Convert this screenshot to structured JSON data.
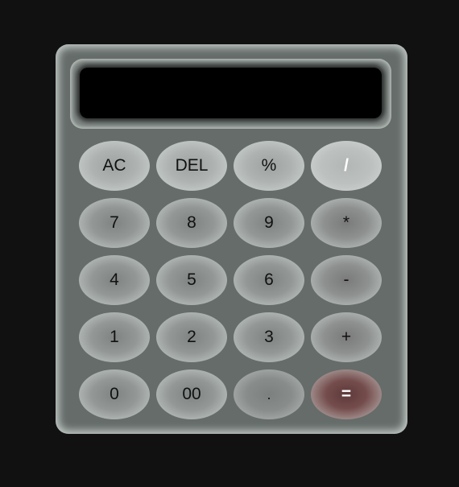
{
  "display": {
    "value": ""
  },
  "keys": [
    {
      "label": "AC",
      "name": "all-clear-button"
    },
    {
      "label": "DEL",
      "name": "delete-button"
    },
    {
      "label": "%",
      "name": "percent-button"
    },
    {
      "label": "/",
      "name": "divide-button"
    },
    {
      "label": "7",
      "name": "digit-7-button"
    },
    {
      "label": "8",
      "name": "digit-8-button"
    },
    {
      "label": "9",
      "name": "digit-9-button"
    },
    {
      "label": "*",
      "name": "multiply-button"
    },
    {
      "label": "4",
      "name": "digit-4-button"
    },
    {
      "label": "5",
      "name": "digit-5-button"
    },
    {
      "label": "6",
      "name": "digit-6-button"
    },
    {
      "label": "-",
      "name": "subtract-button"
    },
    {
      "label": "1",
      "name": "digit-1-button"
    },
    {
      "label": "2",
      "name": "digit-2-button"
    },
    {
      "label": "3",
      "name": "digit-3-button"
    },
    {
      "label": "+",
      "name": "add-button"
    },
    {
      "label": "0",
      "name": "digit-0-button"
    },
    {
      "label": "00",
      "name": "double-zero-button"
    },
    {
      "label": ".",
      "name": "decimal-point-button"
    },
    {
      "label": "=",
      "name": "equals-button"
    }
  ],
  "colors": {
    "page_background": "#111111",
    "body": "#656c6a",
    "display_background": "#000000",
    "equals_accent": "#744c4c"
  }
}
